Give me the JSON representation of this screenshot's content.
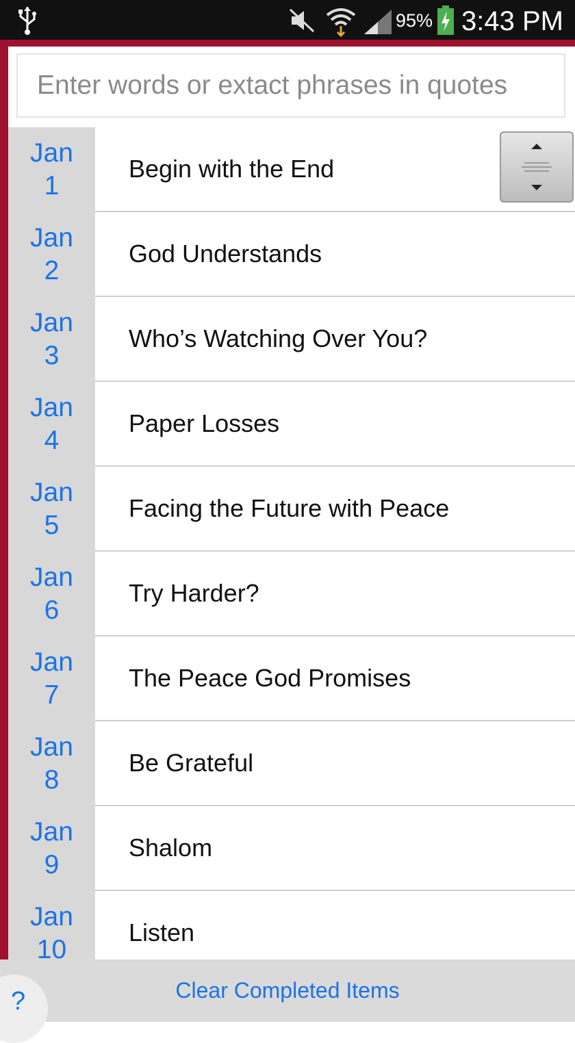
{
  "status_bar": {
    "battery_percent": "95%",
    "time": "3:43 PM",
    "icons": [
      "usb-icon",
      "mute-icon",
      "wifi-icon",
      "signal-icon",
      "battery-charging-icon"
    ]
  },
  "search": {
    "placeholder": "Enter words or extact phrases in quotes",
    "value": ""
  },
  "list": {
    "items": [
      {
        "month": "Jan",
        "day": "1",
        "title": "Begin with the End"
      },
      {
        "month": "Jan",
        "day": "2",
        "title": "God Understands"
      },
      {
        "month": "Jan",
        "day": "3",
        "title": "Who’s Watching Over You?"
      },
      {
        "month": "Jan",
        "day": "4",
        "title": "Paper Losses"
      },
      {
        "month": "Jan",
        "day": "5",
        "title": "Facing the Future with Peace"
      },
      {
        "month": "Jan",
        "day": "6",
        "title": "Try Harder?"
      },
      {
        "month": "Jan",
        "day": "7",
        "title": "The Peace God Promises"
      },
      {
        "month": "Jan",
        "day": "8",
        "title": "Be Grateful"
      },
      {
        "month": "Jan",
        "day": "9",
        "title": "Shalom"
      },
      {
        "month": "Jan",
        "day": "10",
        "title": "Listen"
      }
    ]
  },
  "footer": {
    "clear_label": "Clear Completed Items",
    "help_label": "?"
  },
  "colors": {
    "accent_frame": "#a0112f",
    "link_blue": "#1a73e8",
    "date_column_bg": "#d8d8d8",
    "status_bar_bg": "#111111"
  }
}
